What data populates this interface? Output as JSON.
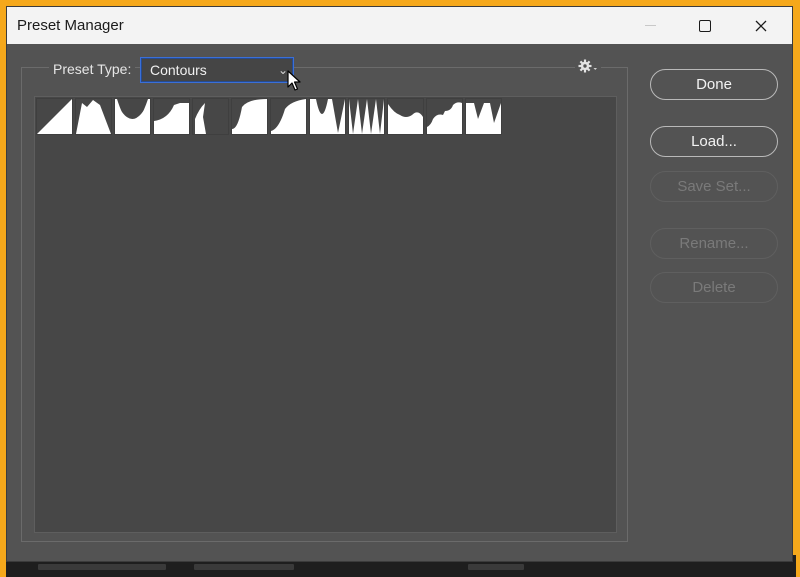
{
  "window": {
    "title": "Preset Manager"
  },
  "preset_type": {
    "label": "Preset Type:",
    "value": "Contours"
  },
  "icons": {
    "minimize": "minimize-icon",
    "maximize": "maximize-icon",
    "close": "close-icon",
    "gear": "gear-icon",
    "cursor": "mouse-cursor-icon"
  },
  "contours": [
    "contour-linear",
    "contour-cone",
    "contour-cove-deep",
    "contour-cove-shallow",
    "contour-gaussian",
    "contour-half-round",
    "contour-ring",
    "contour-ring-double",
    "contour-ring-triple",
    "contour-rolling-slope",
    "contour-rounded-steps",
    "contour-sawtooth"
  ],
  "buttons": {
    "done": "Done",
    "load": "Load...",
    "save_set": "Save Set...",
    "rename": "Rename...",
    "delete": "Delete"
  },
  "colors": {
    "accent": "#3a6fd8",
    "background": "#535353",
    "list_bg": "#474747"
  }
}
